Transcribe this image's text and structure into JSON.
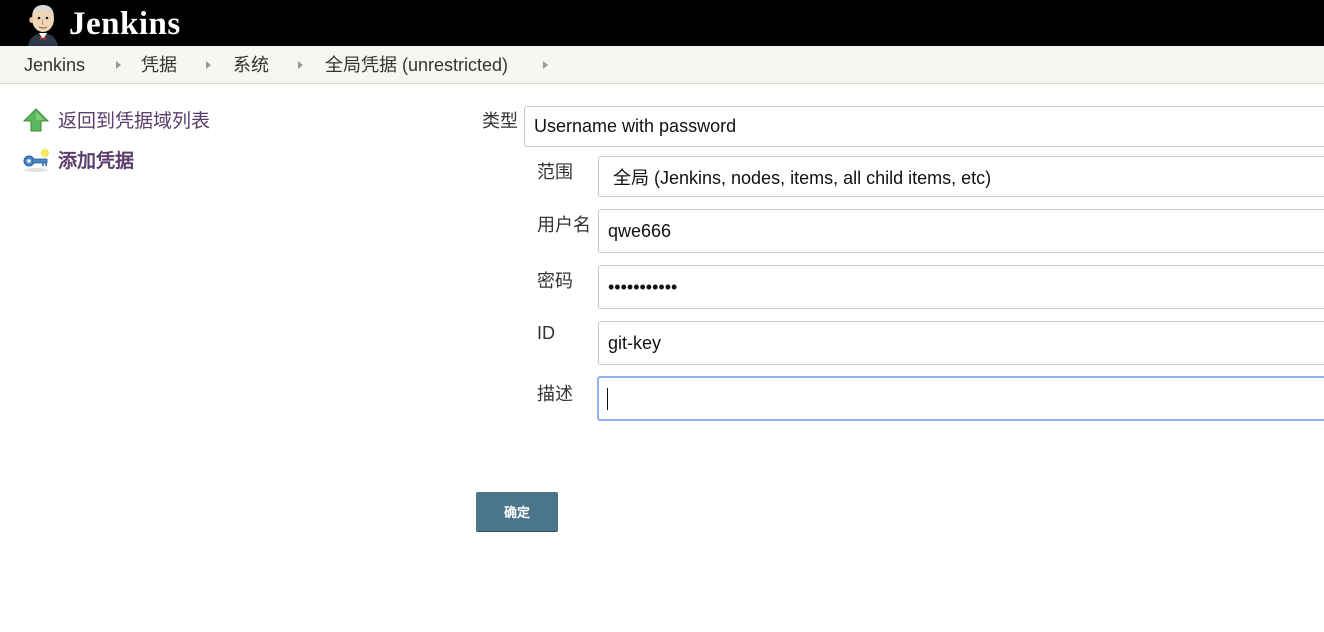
{
  "app": {
    "title": "Jenkins"
  },
  "breadcrumb": [
    "Jenkins",
    "凭据",
    "系统",
    "全局凭据 (unrestricted)"
  ],
  "sidebar": {
    "back_label": "返回到凭据域列表",
    "add_label": "添加凭据"
  },
  "form": {
    "kind_label": "类型",
    "kind_value": "Username with password",
    "scope_label": "范围",
    "scope_value": "全局 (Jenkins, nodes, items, all child items, etc)",
    "username_label": "用户名",
    "username_value": "qwe666",
    "password_label": "密码",
    "password_value": "•••••••••••",
    "id_label": "ID",
    "id_value": "git-key",
    "description_label": "描述",
    "description_value": "",
    "submit_label": "确定"
  },
  "icons": {
    "logo": "jenkins-butler-logo",
    "back": "green-up-arrow-icon",
    "add": "key-icon"
  }
}
